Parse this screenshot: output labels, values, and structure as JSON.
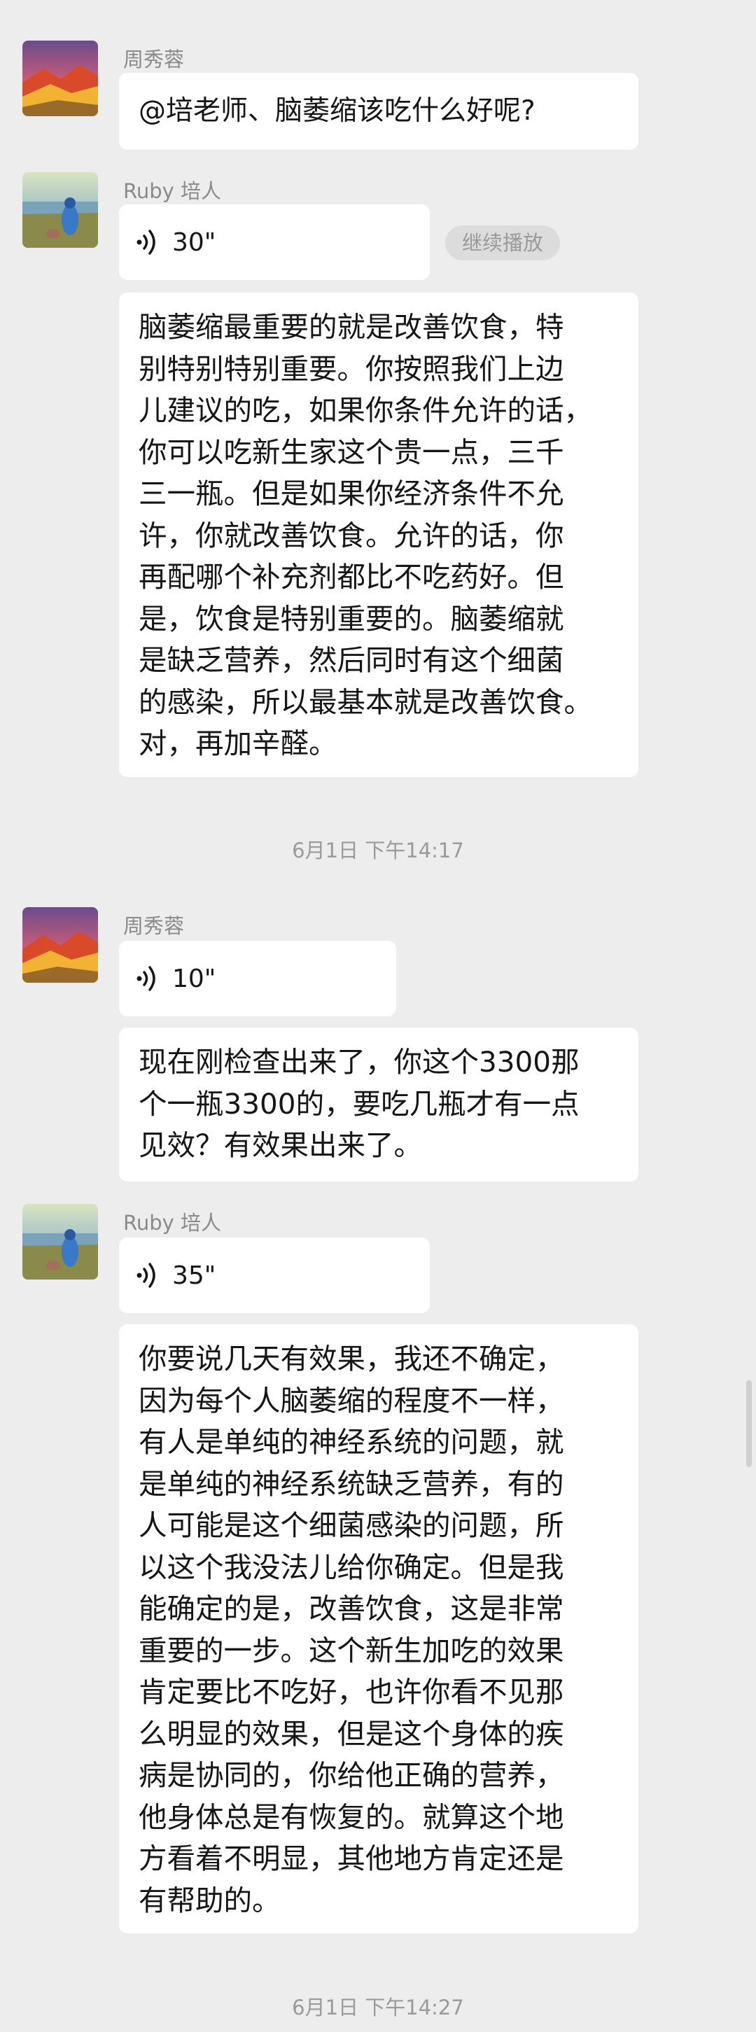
{
  "messages": [
    {
      "sender": "周秀蓉",
      "text": "@培老师、脑萎缩该吃什么好呢?"
    },
    {
      "sender": "Ruby 培人",
      "voice_duration": "30\"",
      "continue_label": "继续播放",
      "text": "脑萎缩最重要的就是改善饮食，特\n别特别特别重要。你按照我们上边\n儿建议的吃，如果你条件允许的话，\n你可以吃新生家这个贵一点，三千\n三一瓶。但是如果你经济条件不允\n许，你就改善饮食。允许的话，你\n再配哪个补充剂都比不吃药好。但\n是，饮食是特别重要的。脑萎缩就\n是缺乏营养，然后同时有这个细菌\n的感染，所以最基本就是改善饮食。\n对，再加辛醛。"
    },
    {
      "timestamp": "6月1日 下午14:17"
    },
    {
      "sender": "周秀蓉",
      "voice_duration": "10\"",
      "text": "现在刚检查出来了，你这个3300那\n个一瓶3300的，要吃几瓶才有一点\n见效？有效果出来了。"
    },
    {
      "sender": "Ruby 培人",
      "voice_duration": "35\"",
      "text": "你要说几天有效果，我还不确定，\n因为每个人脑萎缩的程度不一样，\n有人是单纯的神经系统的问题，就\n是单纯的神经系统缺乏营养，有的\n人可能是这个细菌感染的问题，所\n以这个我没法儿给你确定。但是我\n能确定的是，改善饮食，这是非常\n重要的一步。这个新生加吃的效果\n肯定要比不吃好，也许你看不见那\n么明显的效果，但是这个身体的疾\n病是协同的，你给他正确的营养，\n他身体总是有恢复的。就算这个地\n方看着不明显，其他地方肯定还是\n有帮助的。"
    },
    {
      "timestamp": "6月1日 下午14:27"
    }
  ]
}
